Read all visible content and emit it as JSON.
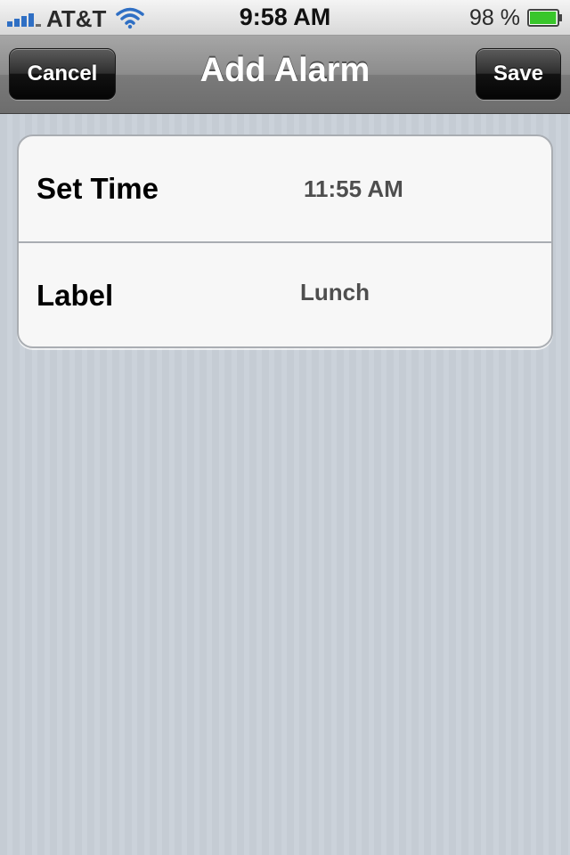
{
  "status_bar": {
    "carrier": "AT&T",
    "signal_bars": 4,
    "time": "9:58 AM",
    "battery_percent": "98 %",
    "battery_level": 0.98,
    "battery_color": "#39c62b"
  },
  "nav": {
    "title": "Add Alarm",
    "cancel_label": "Cancel",
    "save_label": "Save"
  },
  "table": {
    "rows": [
      {
        "title": "Set Time",
        "value": "11:55 AM"
      },
      {
        "title": "Label",
        "value": "Lunch"
      }
    ]
  },
  "icons": {
    "signal": "signal-bars-icon",
    "wifi": "wifi-icon",
    "battery": "battery-icon"
  }
}
